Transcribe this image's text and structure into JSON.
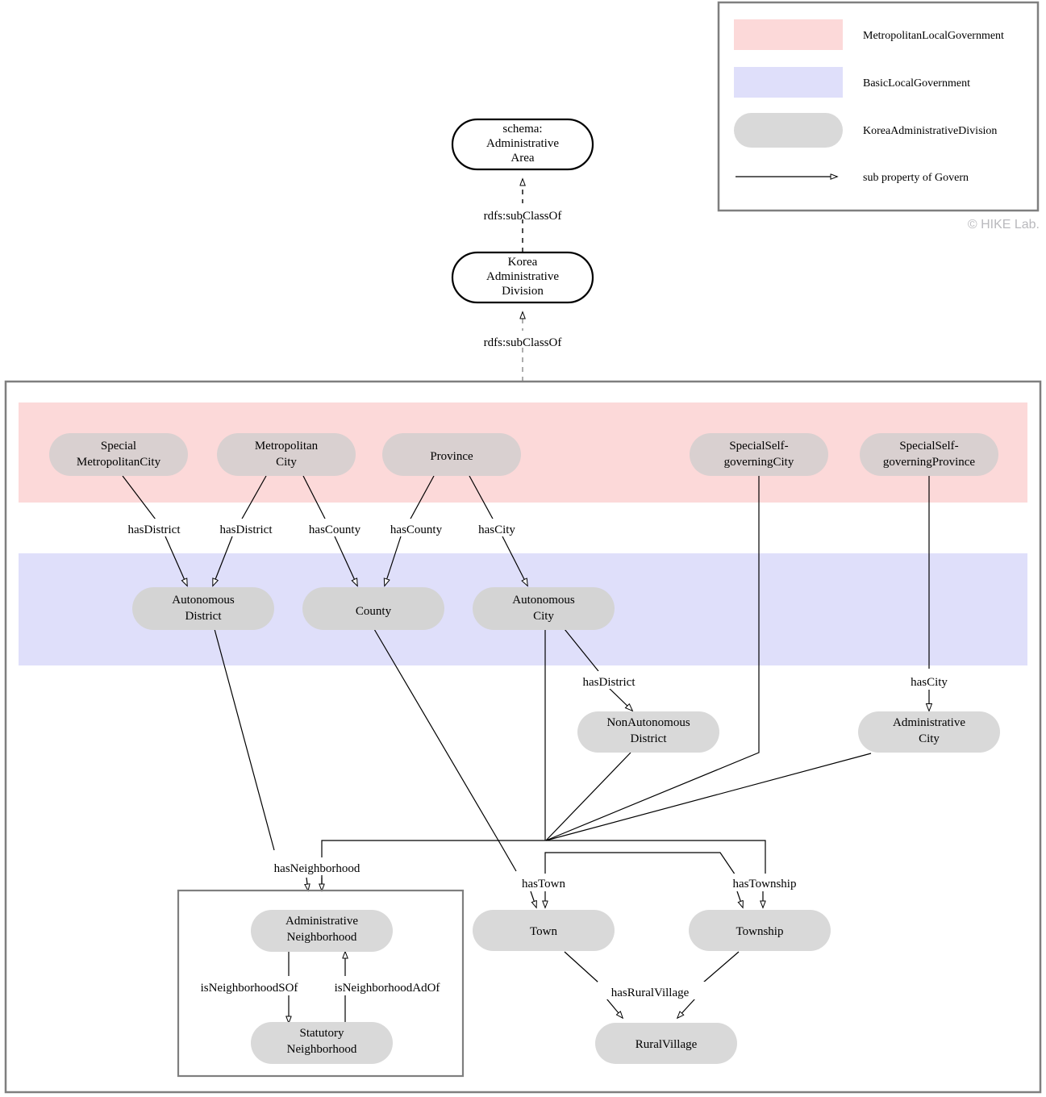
{
  "credit": "© HIKE Lab.",
  "colors": {
    "metropolitan_band": "#fcd9d9",
    "basic_band": "#dfdffa",
    "node_fill_top": "#d9d0d0",
    "node_fill": "#d9d9d9",
    "node_stroke": "#000000",
    "frame_stroke": "#7f7f7f",
    "edge_stroke": "#000000"
  },
  "legend": {
    "items": [
      {
        "kind": "swatch-rect",
        "name": "metropolitan-local-government-swatch",
        "label": "MetropolitanLocalGovernment",
        "color": "#fcd9d9"
      },
      {
        "kind": "swatch-rect",
        "name": "basic-local-government-swatch",
        "label": "BasicLocalGovernment",
        "color": "#dfdffa"
      },
      {
        "kind": "swatch-round",
        "name": "korea-administrative-division-swatch",
        "label": "KoreaAdministrativeDivision",
        "color": "#d9d9d9"
      },
      {
        "kind": "swatch-arrow",
        "name": "sub-property-of-govern-arrow",
        "label": "sub property of Govern",
        "color": "#000000"
      }
    ]
  },
  "top_hierarchy": {
    "nodes": [
      {
        "id": "schema-administrative-area",
        "lines": [
          "schema:",
          "Administrative",
          "Area"
        ]
      },
      {
        "id": "korea-administrative-division",
        "lines": [
          "Korea",
          "Administrative",
          "Division"
        ]
      }
    ],
    "edges": [
      {
        "id": "subclassof-1",
        "label": "rdfs:subClassOf"
      },
      {
        "id": "subclassof-2",
        "label": "rdfs:subClassOf"
      }
    ]
  },
  "bands": [
    {
      "id": "metropolitan-local-government-band",
      "label": "MetropolitanLocalGovernment"
    },
    {
      "id": "basic-local-government-band",
      "label": "BasicLocalGovernment"
    }
  ],
  "nodes": [
    {
      "id": "special-metropolitan-city",
      "lines": [
        "Special",
        "MetropolitanCity"
      ]
    },
    {
      "id": "metropolitan-city",
      "lines": [
        "Metropolitan",
        "City"
      ]
    },
    {
      "id": "province",
      "lines": [
        "Province"
      ]
    },
    {
      "id": "special-self-governing-city",
      "lines": [
        "SpecialSelf-",
        "governingCity"
      ]
    },
    {
      "id": "special-self-governing-province",
      "lines": [
        "SpecialSelf-",
        "governingProvince"
      ]
    },
    {
      "id": "autonomous-district",
      "lines": [
        "Autonomous",
        "District"
      ]
    },
    {
      "id": "county",
      "lines": [
        "County"
      ]
    },
    {
      "id": "autonomous-city",
      "lines": [
        "Autonomous",
        "City"
      ]
    },
    {
      "id": "non-autonomous-district",
      "lines": [
        "NonAutonomous",
        "District"
      ]
    },
    {
      "id": "administrative-city",
      "lines": [
        "Administrative",
        "City"
      ]
    },
    {
      "id": "administrative-neighborhood",
      "lines": [
        "Administrative",
        "Neighborhood"
      ]
    },
    {
      "id": "statutory-neighborhood",
      "lines": [
        "Statutory",
        "Neighborhood"
      ]
    },
    {
      "id": "town",
      "lines": [
        "Town"
      ]
    },
    {
      "id": "township",
      "lines": [
        "Township"
      ]
    },
    {
      "id": "rural-village",
      "lines": [
        "RuralVillage"
      ]
    }
  ],
  "edge_labels": [
    {
      "id": "has-district-1",
      "label": "hasDistrict"
    },
    {
      "id": "has-district-2",
      "label": "hasDistrict"
    },
    {
      "id": "has-county-1",
      "label": "hasCounty"
    },
    {
      "id": "has-county-2",
      "label": "hasCounty"
    },
    {
      "id": "has-city-1",
      "label": "hasCity"
    },
    {
      "id": "has-district-3",
      "label": "hasDistrict"
    },
    {
      "id": "has-city-2",
      "label": "hasCity"
    },
    {
      "id": "has-neighborhood",
      "label": "hasNeighborhood"
    },
    {
      "id": "has-town",
      "label": "hasTown"
    },
    {
      "id": "has-township",
      "label": "hasTownship"
    },
    {
      "id": "is-neighborhood-s-of",
      "label": "isNeighborhoodSOf"
    },
    {
      "id": "is-neighborhood-ad-of",
      "label": "isNeighborhoodAdOf"
    },
    {
      "id": "has-rural-village",
      "label": "hasRuralVillage"
    }
  ]
}
